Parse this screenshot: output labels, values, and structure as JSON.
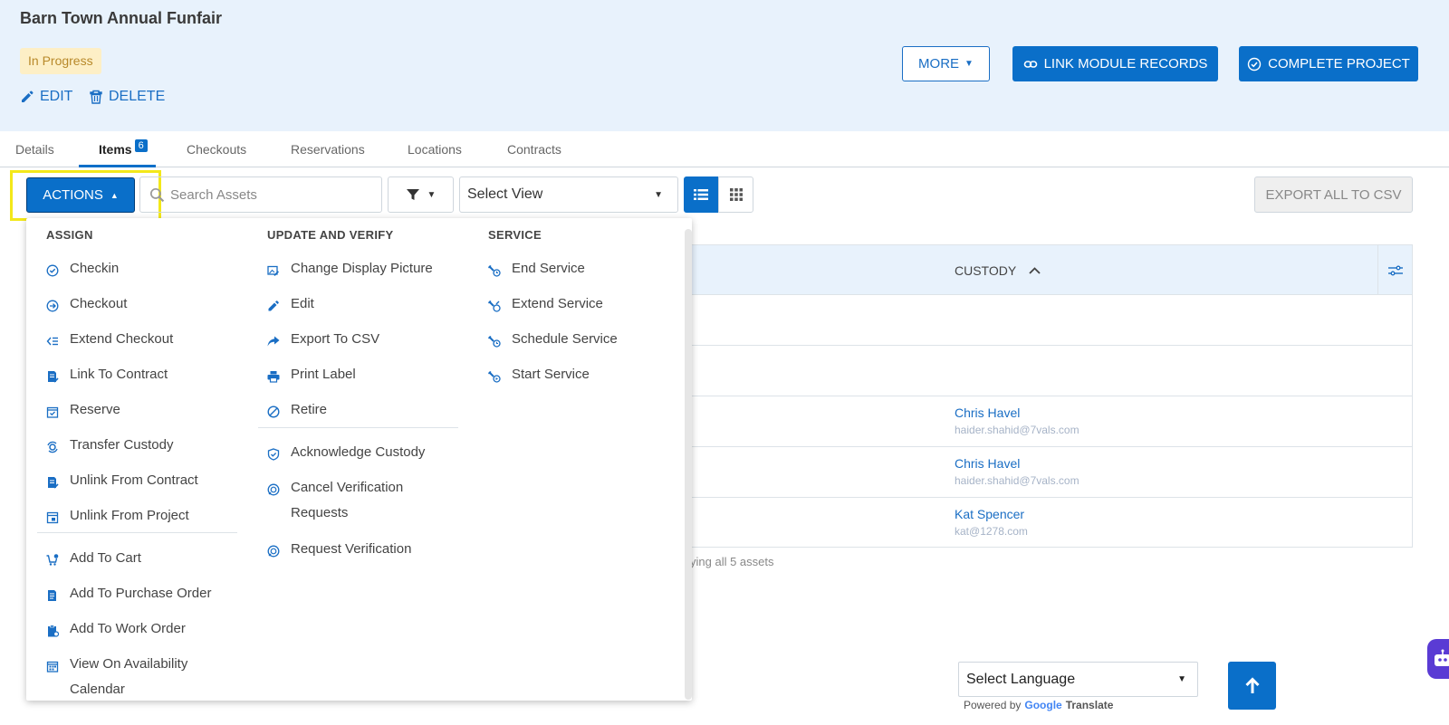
{
  "project": {
    "title": "Barn Town Annual Funfair",
    "status": "In Progress",
    "edit_label": "EDIT",
    "delete_label": "DELETE",
    "more_label": "MORE",
    "link_label": "LINK MODULE RECORDS",
    "complete_label": "COMPLETE PROJECT"
  },
  "tabs": [
    {
      "label": "Details"
    },
    {
      "label": "Items",
      "count": "6"
    },
    {
      "label": "Checkouts"
    },
    {
      "label": "Reservations"
    },
    {
      "label": "Locations"
    },
    {
      "label": "Contracts"
    }
  ],
  "toolbar": {
    "actions_label": "ACTIONS",
    "search_placeholder": "Search Assets",
    "select_view": "Select View",
    "export_label": "EXPORT ALL TO CSV"
  },
  "menu": {
    "assign": {
      "heading": "ASSIGN",
      "items": [
        "Checkin",
        "Checkout",
        "Extend Checkout",
        "Link To Contract",
        "Reserve",
        "Transfer Custody",
        "Unlink From Contract",
        "Unlink From Project"
      ],
      "items2": [
        "Add To Cart",
        "Add To Purchase Order",
        "Add To Work Order"
      ],
      "availability_line1": "View On Availability",
      "availability_line2": "Calendar"
    },
    "update": {
      "heading": "UPDATE AND VERIFY",
      "items": [
        "Change Display Picture",
        "Edit",
        "Export To CSV",
        "Print Label",
        "Retire"
      ],
      "acknowledge": "Acknowledge Custody",
      "cancel_line1": "Cancel Verification",
      "cancel_line2": "Requests",
      "request": "Request Verification"
    },
    "service": {
      "heading": "SERVICE",
      "items": [
        "End Service",
        "Extend Service",
        "Schedule Service",
        "Start Service"
      ]
    }
  },
  "table": {
    "custody_header": "CUSTODY",
    "rows": [
      {
        "name": "",
        "email": ""
      },
      {
        "name": "",
        "email": ""
      },
      {
        "name": "Chris Havel",
        "email": "haider.shahid@7vals.com"
      },
      {
        "name": "Chris Havel",
        "email": "haider.shahid@7vals.com"
      },
      {
        "name": "Kat Spencer",
        "email": "kat@1278.com"
      }
    ],
    "footer": "ying all 5 assets"
  },
  "translate": {
    "select_language": "Select Language",
    "powered_by": "Powered by",
    "google": "Google",
    "translate": "Translate"
  },
  "colors": {
    "primary": "#0a6fc9",
    "header_bg": "#e8f2fc",
    "badge_bg": "#fdefc6",
    "highlight": "#f3e81a"
  }
}
